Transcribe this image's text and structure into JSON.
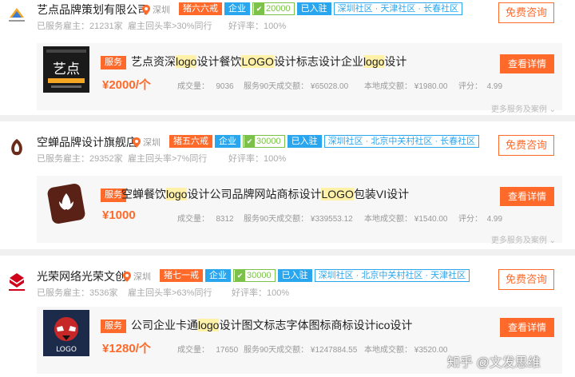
{
  "shops": [
    {
      "name": "艺点品牌策划有限公司",
      "location": "深圳",
      "rank": "猪六六戒",
      "enterprise": "企业",
      "deposit": "20000",
      "joined": "已入驻",
      "communities": "深圳社区 · 天津社区 · 长春社区",
      "served": "已服务雇主：21231家",
      "repurchase": "雇主回头率>30%同行",
      "praise": "好评率：100%",
      "consult": "免费咨询",
      "logo_text": "艺点",
      "service": {
        "tag": "服务",
        "title_parts": [
          "艺点资深",
          "logo",
          "设计餐饮",
          "LOGO",
          "设计标志设计企业",
          "logo",
          "设计"
        ],
        "price": "¥2000/个",
        "volume_label": "成交量：",
        "volume": "9036",
        "revenue90_label": "服务90天成交额：",
        "revenue90": "¥65028.00",
        "local_label": "本地成交额：",
        "local": "¥1980.00",
        "score_label": "评分：",
        "score": "4.99",
        "detail": "查看详情"
      },
      "more": "更多服务及案例"
    },
    {
      "name": "空蝉品牌设计旗舰店",
      "location": "深圳",
      "rank": "猪五六戒",
      "enterprise": "企业",
      "deposit": "30000",
      "joined": "已入驻",
      "communities": "深圳社区 · 北京中关村社区 · 长春社区",
      "served": "已服务雇主：29352家",
      "repurchase": "雇主回头率>7%同行",
      "praise": "好评率：100%",
      "consult": "免费咨询",
      "logo_text": "",
      "service": {
        "tag": "服务",
        "title_parts": [
          "空蝉餐饮",
          "logo",
          "设计公司品牌网站商标设计",
          "LOGO",
          "包装VI设计"
        ],
        "price": "¥1000",
        "volume_label": "成交量：",
        "volume": "8312",
        "revenue90_label": "服务90天成交额：",
        "revenue90": "¥339553.12",
        "local_label": "本地成交额：",
        "local": "¥1540.00",
        "score_label": "评分：",
        "score": "4.99",
        "detail": "查看详情"
      },
      "more": "更多服务及案例"
    },
    {
      "name": "光荣网络光荣文创",
      "location": "深圳",
      "rank": "猪七一戒",
      "enterprise": "企业",
      "deposit": "30000",
      "joined": "已入驻",
      "communities": "深圳社区 · 北京中关村社区 · 天津社区",
      "served": "已服务雇主：3536家",
      "repurchase": "雇主回头率>63%同行",
      "praise": "好评率：100%",
      "consult": "免费咨询",
      "logo_text": "LOGO",
      "service": {
        "tag": "服务",
        "title_parts": [
          "公司企业卡通",
          "logo",
          "设计图文标志字体图标商标设计ico设计"
        ],
        "price": "¥1280/个",
        "volume_label": "成交量：",
        "volume": "17650",
        "revenue90_label": "服务90天成交额：",
        "revenue90": "¥1247884.55",
        "local_label": "本地成交额：",
        "local": "¥3520.00",
        "score_label": "",
        "score": "",
        "detail": "查看详情"
      },
      "more": ""
    }
  ],
  "watermark": "知乎 @文发思维",
  "colors": {
    "accent": "#ff6a2a",
    "blue": "#2aa6ee",
    "green": "#7cc24a"
  }
}
